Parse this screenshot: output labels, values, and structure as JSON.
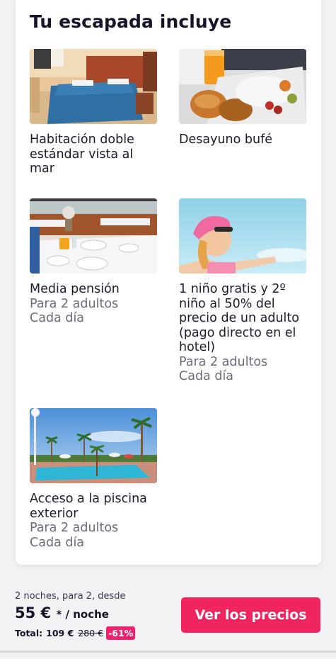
{
  "section": {
    "title": "Tu escapada incluye"
  },
  "items": [
    {
      "name": "Habitación doble estándar vista al mar",
      "sub": []
    },
    {
      "name": "Desayuno bufé",
      "sub": []
    },
    {
      "name": "Media pensión",
      "sub": [
        "Para 2 adultos",
        "Cada día"
      ]
    },
    {
      "name": "1 niño gratis y 2º niño al 50% del precio de un adulto (pago directo en el hotel)",
      "sub": [
        "Para 2 adultos",
        "Cada día"
      ]
    },
    {
      "name": "Acceso a la piscina exterior",
      "sub": [
        "Para 2 adultos",
        "Cada día"
      ]
    }
  ],
  "footer": {
    "nights_text": "2 noches, para 2, desde",
    "price": "55 €",
    "per_night": "* / noche",
    "total_label": "Total:",
    "total_value": "109 €",
    "old_price": "280 €",
    "discount": "-61%",
    "cta_label": "Ver los precios"
  },
  "colors": {
    "accent": "#f0245f",
    "discount_badge": "#f0226e"
  }
}
